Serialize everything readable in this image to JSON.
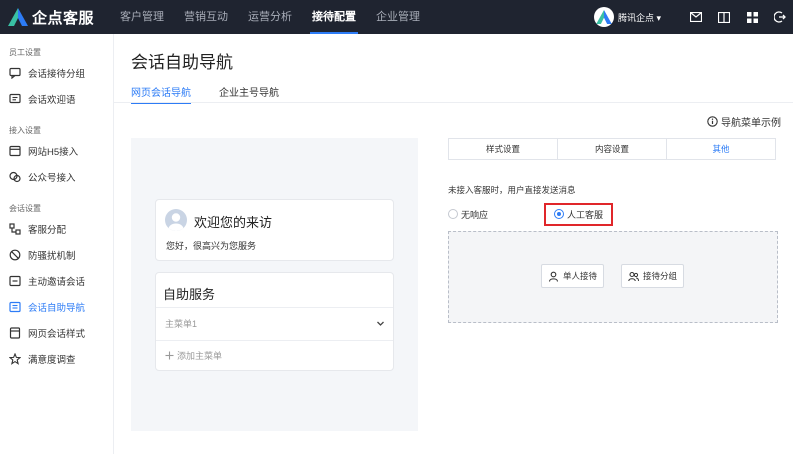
{
  "app": {
    "logo_text": "企点客服",
    "brand_color": "#2d7cf6"
  },
  "nav": {
    "items": [
      {
        "label": "客户管理"
      },
      {
        "label": "营销互动"
      },
      {
        "label": "运营分析"
      },
      {
        "label": "接待配置",
        "active": true
      },
      {
        "label": "企业管理"
      }
    ]
  },
  "user": {
    "name": "腾讯企点"
  },
  "toolbar_icons": [
    "mail-icon",
    "book-icon",
    "apps-icon",
    "logout-icon"
  ],
  "sidebar": {
    "groups": [
      {
        "title": "员工设置",
        "items": [
          {
            "label": "会话接待分组",
            "icon": "chat-group-icon"
          },
          {
            "label": "会话欢迎语",
            "icon": "welcome-icon"
          }
        ]
      },
      {
        "title": "接入设置",
        "items": [
          {
            "label": "网站H5接入",
            "icon": "web-icon"
          },
          {
            "label": "公众号接入",
            "icon": "wechat-icon"
          }
        ]
      },
      {
        "title": "会话设置",
        "items": [
          {
            "label": "客服分配",
            "icon": "assign-icon"
          },
          {
            "label": "防骚扰机制",
            "icon": "shield-icon"
          },
          {
            "label": "主动邀请会话",
            "icon": "invite-icon"
          },
          {
            "label": "会话自助导航",
            "icon": "navigation-icon",
            "active": true
          },
          {
            "label": "网页会话样式",
            "icon": "style-icon"
          },
          {
            "label": "满意度调查",
            "icon": "survey-icon"
          }
        ]
      }
    ]
  },
  "main": {
    "title": "会话自助导航",
    "tabs": [
      {
        "label": "网页会话导航",
        "active": true
      },
      {
        "label": "企业主号导航"
      }
    ],
    "example_link": "导航菜单示例"
  },
  "preview": {
    "welcome_title": "欢迎您的来访",
    "welcome_sub": "您好，很高兴为您服务",
    "service_title": "自助服务",
    "menu_item": "主菜单1",
    "add_menu": "添加主菜单"
  },
  "settings": {
    "segments": [
      {
        "label": "样式设置"
      },
      {
        "label": "内容设置"
      },
      {
        "label": "其他",
        "active": true
      }
    ],
    "description": "未接入客服时，用户直接发送消息",
    "radio_options": [
      {
        "label": "无响应",
        "checked": false
      },
      {
        "label": "人工客服",
        "checked": true
      }
    ],
    "buttons": [
      {
        "label": "单人接待"
      },
      {
        "label": "接待分组"
      }
    ]
  }
}
